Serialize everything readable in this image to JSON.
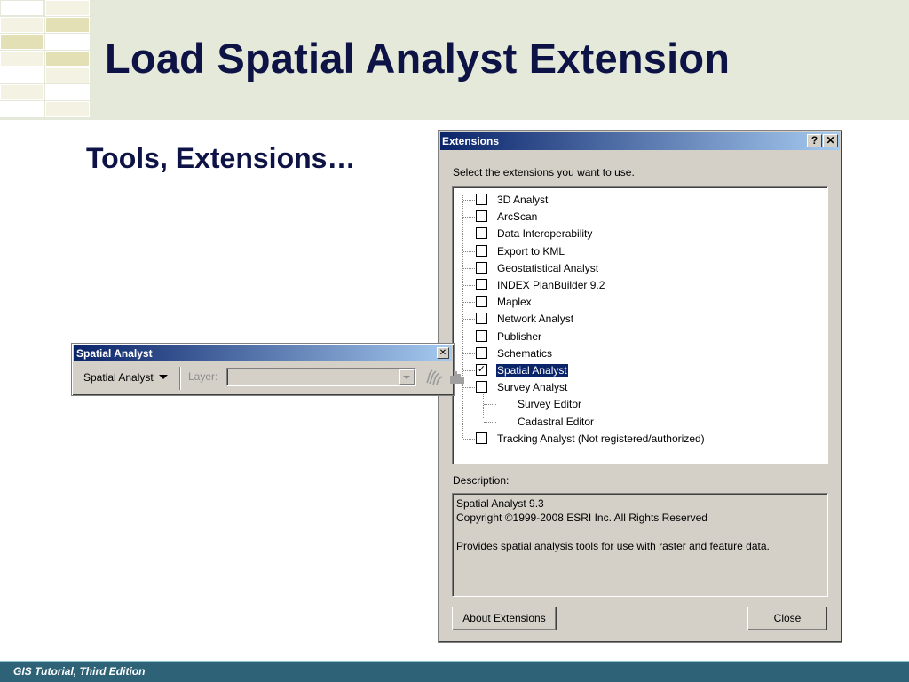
{
  "slide": {
    "title": "Load Spatial Analyst Extension",
    "subtitle": "Tools, Extensions…",
    "footer": "GIS Tutorial, Third Edition",
    "colors": {
      "title": "#0e1346",
      "header_band": "#e5e9d9",
      "footer": "#2e6277"
    }
  },
  "extensions_dialog": {
    "title": "Extensions",
    "help_label": "?",
    "close_glyph": "✕",
    "prompt": "Select the extensions you want to use.",
    "items": [
      {
        "label": "3D Analyst",
        "checked": false
      },
      {
        "label": "ArcScan",
        "checked": false
      },
      {
        "label": "Data Interoperability",
        "checked": false
      },
      {
        "label": "Export to KML",
        "checked": false
      },
      {
        "label": "Geostatistical Analyst",
        "checked": false
      },
      {
        "label": "INDEX PlanBuilder 9.2",
        "checked": false
      },
      {
        "label": "Maplex",
        "checked": false
      },
      {
        "label": "Network Analyst",
        "checked": false
      },
      {
        "label": "Publisher",
        "checked": false
      },
      {
        "label": "Schematics",
        "checked": false
      },
      {
        "label": "Spatial Analyst",
        "checked": true,
        "selected": true
      },
      {
        "label": "Survey Analyst",
        "checked": false
      },
      {
        "label": "Survey Editor",
        "child": true
      },
      {
        "label": "Cadastral Editor",
        "child": true
      },
      {
        "label": "Tracking Analyst (Not registered/authorized)",
        "checked": false
      }
    ],
    "description_label": "Description:",
    "description_lines": [
      "Spatial Analyst 9.3",
      "Copyright ©1999-2008 ESRI Inc. All Rights Reserved",
      "",
      "Provides spatial analysis tools for use with raster and feature data."
    ],
    "about_button": "About Extensions",
    "close_button": "Close"
  },
  "toolbar": {
    "title": "Spatial Analyst",
    "close_glyph": "✕",
    "menu_label": "Spatial Analyst",
    "layer_label": "Layer:",
    "layer_value": "",
    "icons": [
      "contour-icon",
      "histogram-icon"
    ]
  }
}
